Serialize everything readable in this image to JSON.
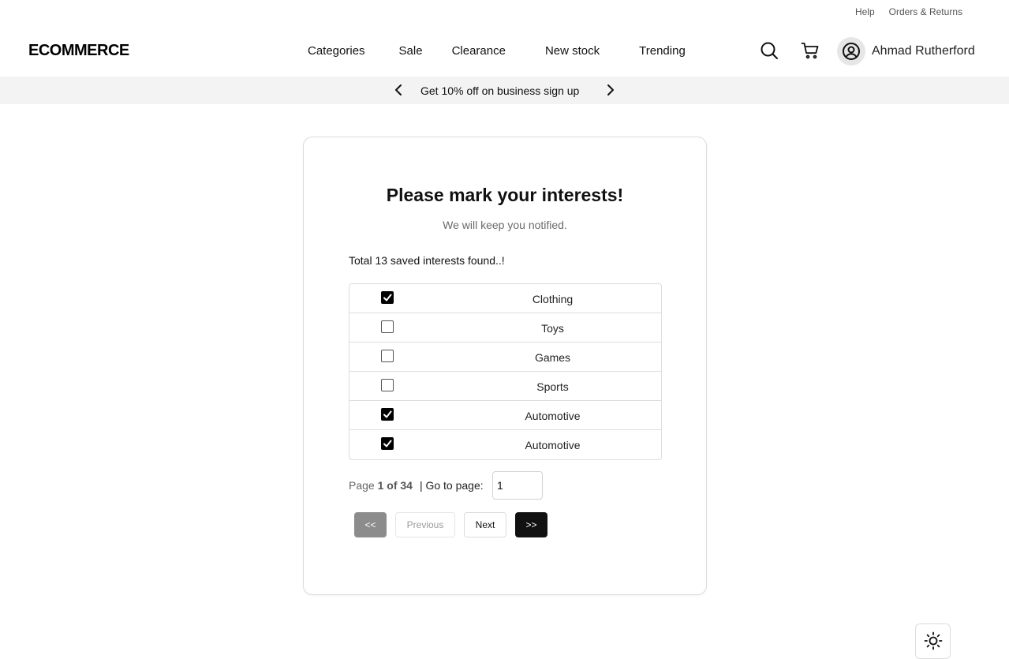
{
  "topbar": {
    "links": [
      "Help",
      "Orders & Returns"
    ]
  },
  "header": {
    "logo": "ECOMMERCE",
    "nav": [
      "Categories",
      "Sale",
      "Clearance",
      "New stock",
      "Trending"
    ],
    "icons": {
      "search": "search-icon",
      "cart": "cart-icon",
      "user": "user-circle-icon"
    },
    "username": "Ahmad Rutherford"
  },
  "promo": {
    "text": "Get 10% off on business sign up"
  },
  "card": {
    "title": "Please mark your interests!",
    "subtitle": "We will keep you notified.",
    "total": "Total 13 saved interests found..!",
    "interests": [
      {
        "label": "Clothing",
        "checked": true
      },
      {
        "label": "Toys",
        "checked": false
      },
      {
        "label": "Games",
        "checked": false
      },
      {
        "label": "Sports",
        "checked": false
      },
      {
        "label": "Automotive",
        "checked": true
      },
      {
        "label": "Automotive",
        "checked": true
      }
    ],
    "pagination": {
      "page_prefix": "Page",
      "page_current": "1 of 34",
      "goto_label": "| Go to page:",
      "goto_value": "1",
      "first_label": "<<",
      "prev_label": "Previous",
      "next_label": "Next",
      "last_label": ">>"
    }
  },
  "theme_toggle": {
    "icon": "sun-icon"
  },
  "colors": {
    "promo_bg": "#f3f3f3",
    "primary_dark": "#111111",
    "disabled_gray": "#8c8c8c",
    "muted_text": "#6b6b6b"
  }
}
